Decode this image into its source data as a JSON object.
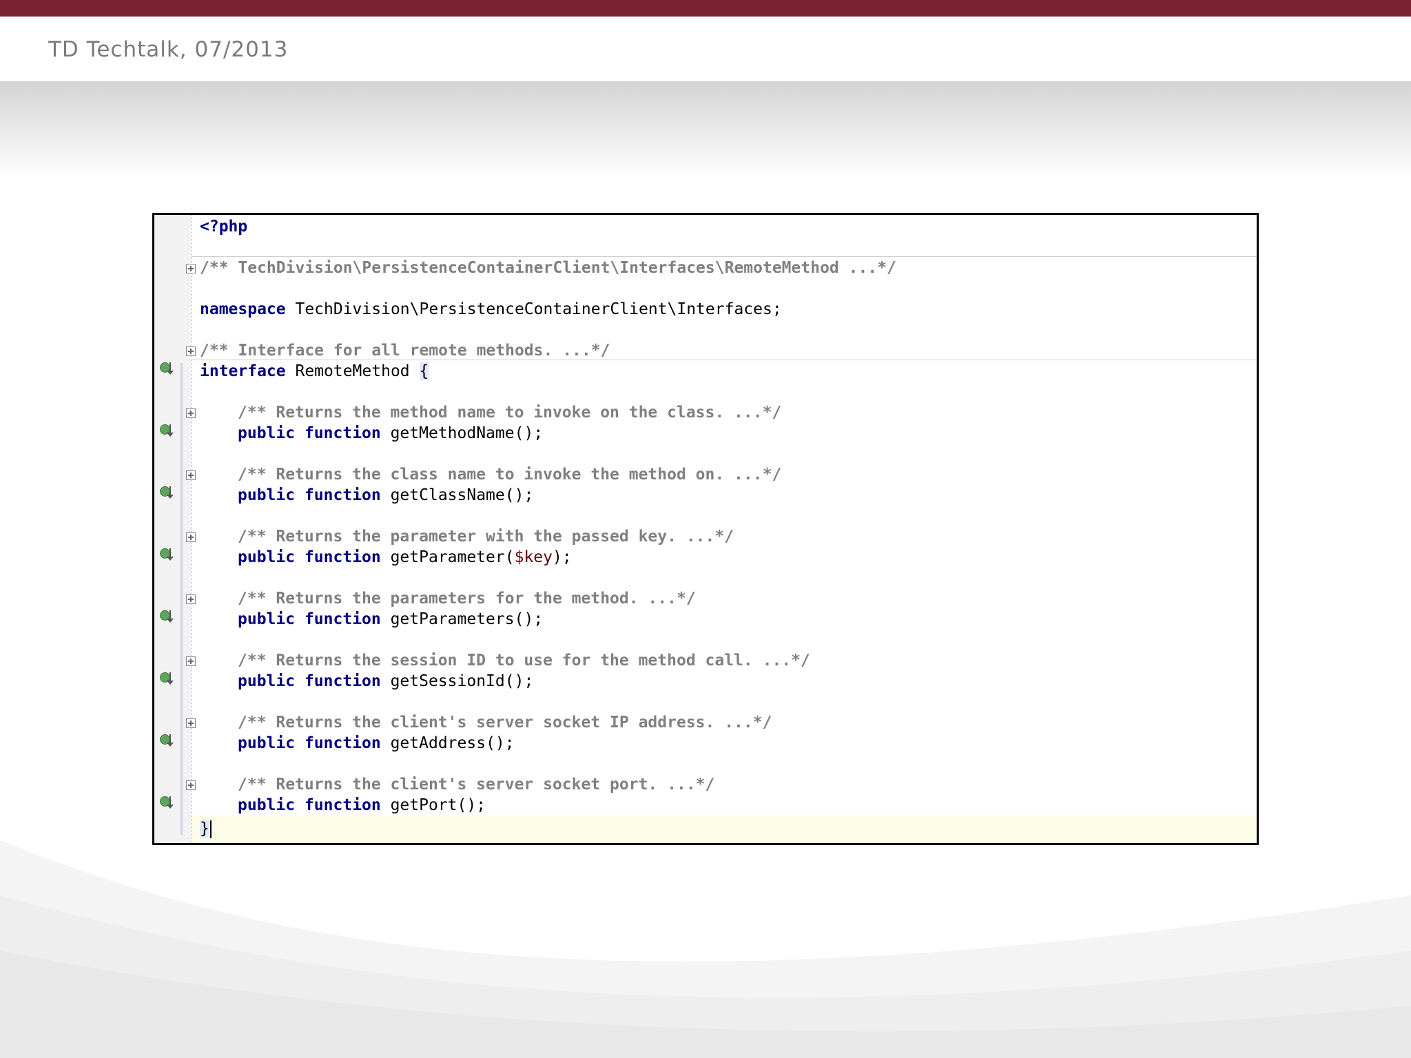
{
  "header": {
    "title": "TD Techtalk, 07/2013"
  },
  "editor": {
    "lines": {
      "php_open": "<?php",
      "file_doc": "/** TechDivision\\PersistenceContainerClient\\Interfaces\\RemoteMethod ...*/",
      "namespace_kw": "namespace",
      "namespace_name": " TechDivision\\PersistenceContainerClient\\Interfaces;",
      "iface_doc": "/** Interface for all remote methods. ...*/",
      "interface_kw": "interface",
      "interface_name": " RemoteMethod ",
      "open_brace": "{",
      "close_brace": "}"
    },
    "public_kw": "public",
    "function_kw": "function",
    "methods": [
      {
        "doc": "/** Returns the method name to invoke on the class. ...*/",
        "name": " getMethodName",
        "args_open": "(",
        "param": "",
        "args_close": ");"
      },
      {
        "doc": "/** Returns the class name to invoke the method on. ...*/",
        "name": " getClassName",
        "args_open": "(",
        "param": "",
        "args_close": ");"
      },
      {
        "doc": "/** Returns the parameter with the passed key. ...*/",
        "name": " getParameter",
        "args_open": "(",
        "param": "$key",
        "args_close": ");"
      },
      {
        "doc": "/** Returns the parameters for the method. ...*/",
        "name": " getParameters",
        "args_open": "(",
        "param": "",
        "args_close": ");"
      },
      {
        "doc": "/** Returns the session ID to use for the method call. ...*/",
        "name": " getSessionId",
        "args_open": "(",
        "param": "",
        "args_close": ");"
      },
      {
        "doc": "/** Returns the client's server socket IP address. ...*/",
        "name": " getAddress",
        "args_open": "(",
        "param": "",
        "args_close": ");"
      },
      {
        "doc": "/** Returns the client's server socket port. ...*/",
        "name": " getPort",
        "args_open": "(",
        "param": "",
        "args_close": ");"
      }
    ],
    "icons": {
      "fold": "fold-expand-icon",
      "implemented": "implemented-method-icon"
    },
    "colors": {
      "keyword": "#000080",
      "comment": "#808080",
      "variable": "#660000",
      "current_line": "#fdfde7"
    }
  }
}
